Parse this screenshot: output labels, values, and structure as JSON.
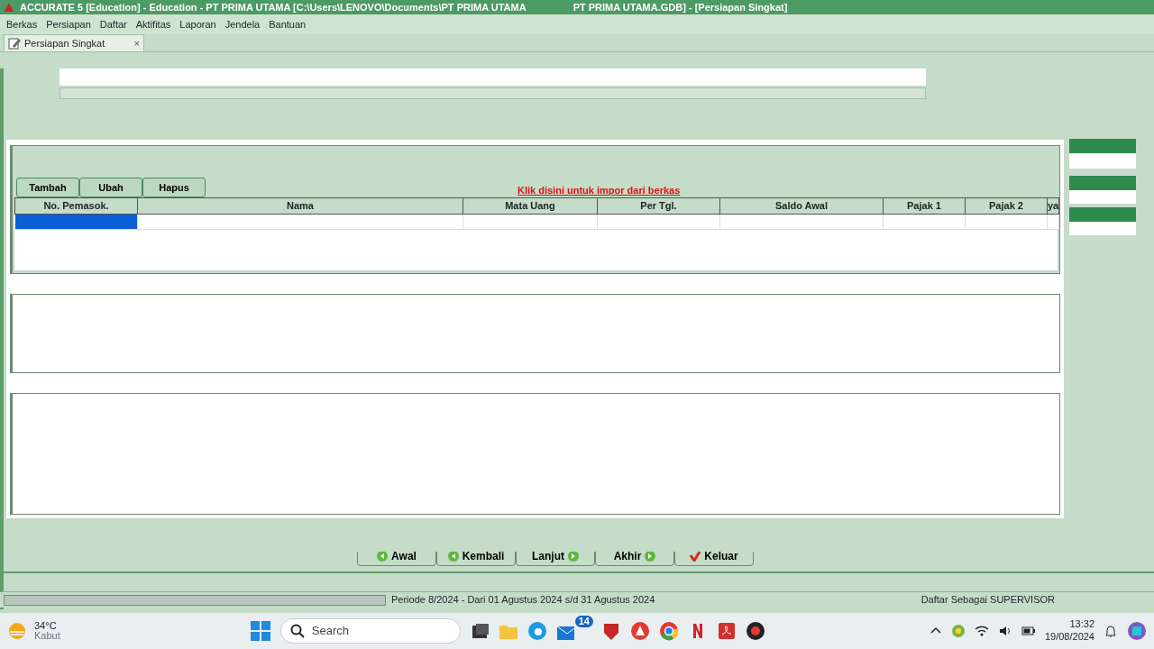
{
  "window": {
    "title_start": "ACCURATE 5 [Education] - Education - PT PRIMA UTAMA   [C:\\Users\\LENOVO\\Documents\\PT PRIMA UTAMA",
    "title_end": "PT PRIMA UTAMA.GDB] - [Persiapan Singkat]"
  },
  "menu": [
    "Berkas",
    "Persiapan",
    "Daftar",
    "Aktifitas",
    "Laporan",
    "Jendela",
    "Bantuan"
  ],
  "doc_tab": {
    "label": "Persiapan Singkat",
    "close": "×"
  },
  "toolbar": [
    "Tambah",
    "Ubah",
    "Hapus"
  ],
  "import_link": "Klik disini untuk impor dari berkas",
  "grid": {
    "columns": [
      "No. Pemasok.",
      "Nama",
      "Mata Uang",
      "Per Tgl.",
      "Saldo Awal",
      "Pajak 1",
      "Pajak 2",
      "ya"
    ],
    "rows": [
      {
        "cells": [
          {
            "selected": true
          },
          {
            "selected": false
          },
          {
            "selected": false
          },
          {
            "selected": false
          },
          {
            "selected": false
          },
          {
            "selected": false
          },
          {
            "selected": false
          },
          {
            "selected": false
          }
        ]
      }
    ]
  },
  "nav_buttons": [
    {
      "label": "Awal",
      "kind": "back"
    },
    {
      "label": "Kembali",
      "kind": "back"
    },
    {
      "label": "Lanjut",
      "kind": "next"
    },
    {
      "label": "Akhir",
      "kind": "next"
    },
    {
      "label": "Keluar",
      "kind": "exit"
    }
  ],
  "status_bar": {
    "progress": {
      "level": 0
    },
    "period": "Periode 8/2024 - Dari 01 Agustus 2024 s/d 31 Agustus 2024",
    "user": "Daftar Sebagai SUPERVISOR"
  },
  "taskbar": {
    "temperature": "34°C",
    "weather": "Kabut",
    "search_placeholder": "Search",
    "mail_badge": "14",
    "time": "13:32",
    "date": "19/08/2024"
  }
}
